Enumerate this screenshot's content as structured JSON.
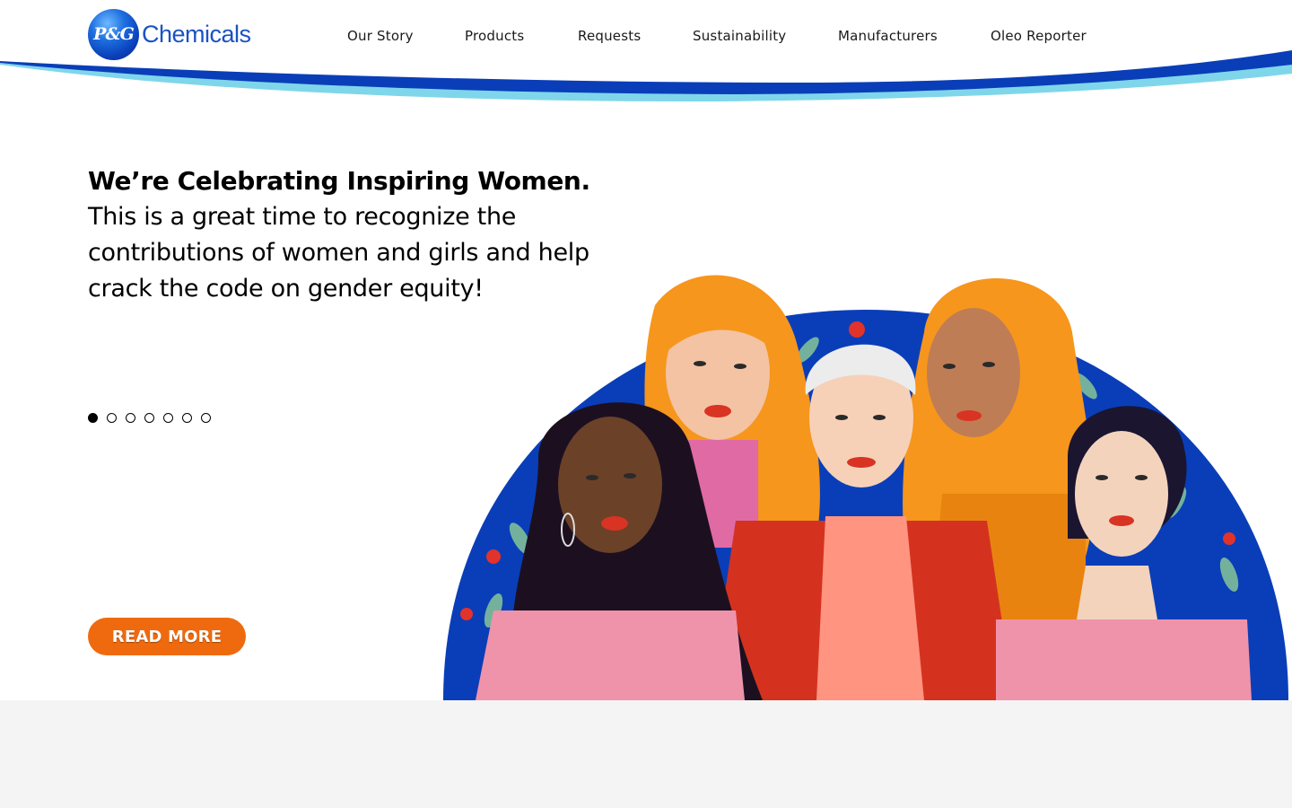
{
  "brand": {
    "logo_mark": "P&G",
    "logo_word": "Chemicals",
    "colors": {
      "primary_blue": "#0a3eb8",
      "light_blue": "#7fd6ea",
      "cta_orange": "#ef6a0e",
      "footer_gray": "#f4f4f4"
    }
  },
  "nav": {
    "items": [
      {
        "label": "Our Story"
      },
      {
        "label": "Products"
      },
      {
        "label": "Requests"
      },
      {
        "label": "Sustainability"
      },
      {
        "label": "Manufacturers"
      },
      {
        "label": "Oleo Reporter"
      }
    ]
  },
  "hero": {
    "title": "We’re Celebrating Inspiring Women.",
    "body": "This is a great time to recognize the contributions of women and girls and help crack the code on gender equity!",
    "cta_label": "READ MORE",
    "carousel": {
      "total_slides": 7,
      "active_index": 1
    },
    "illustration_icon": "women-group-illustration"
  }
}
